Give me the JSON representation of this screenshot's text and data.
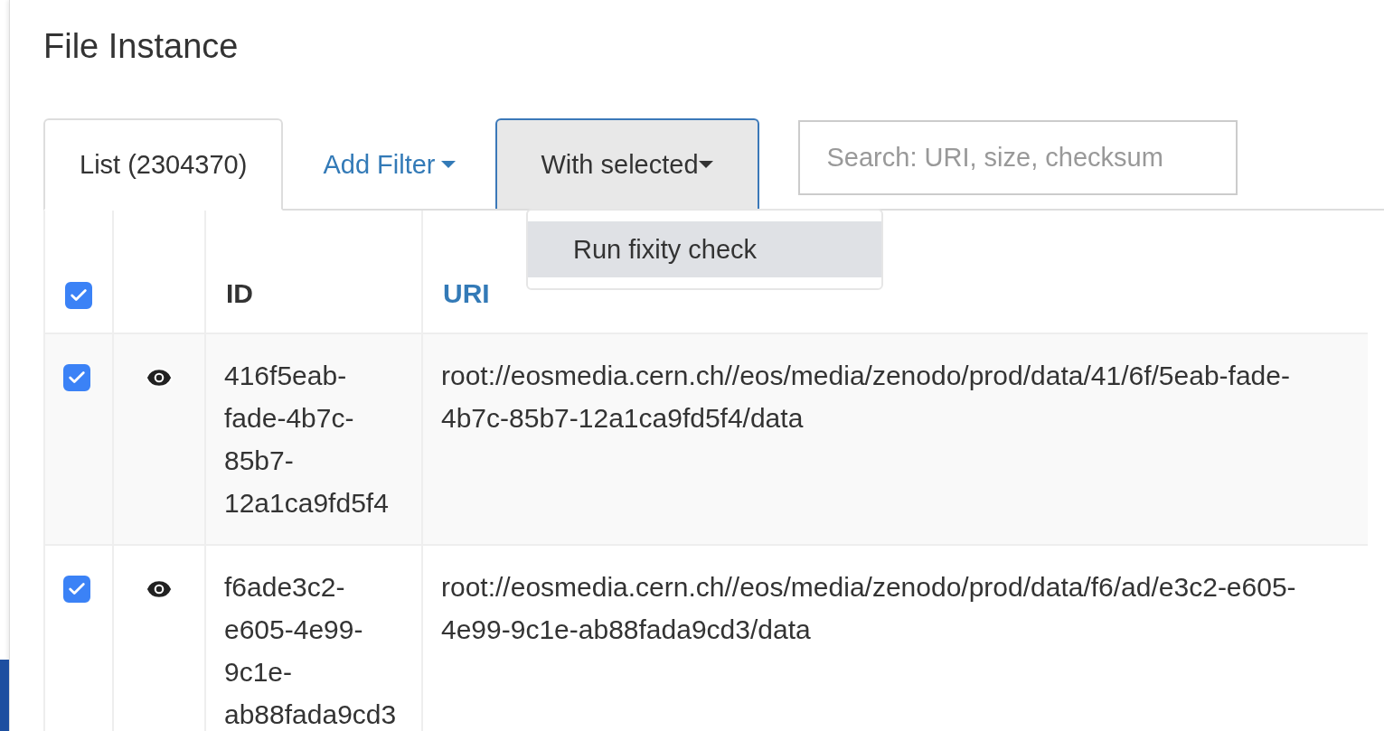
{
  "title": "File Instance",
  "tabs": [
    {
      "label": "List (2304370)",
      "selected": true,
      "kind": "tab"
    },
    {
      "label": "Add Filter",
      "kind": "dropdown-link"
    },
    {
      "label": "With selected",
      "kind": "dropdown-button",
      "open": true
    }
  ],
  "search": {
    "placeholder": "Search: URI, size, checksum"
  },
  "menu": {
    "items": [
      {
        "label": "Run fixity check",
        "selected": true
      }
    ]
  },
  "table": {
    "select_all": {
      "checked": true
    },
    "columns": [
      {
        "kind": "check"
      },
      {
        "kind": "view"
      },
      {
        "label": "ID",
        "kind": "plain"
      },
      {
        "label": "URI",
        "kind": "link"
      }
    ],
    "rows": [
      {
        "checked": true,
        "id": "416f5eab-fade-4b7c-85b7-12a1ca9fd5f4",
        "uri": "root://eosmedia.cern.ch//eos/media/zenodo/prod/data/41/6f/5eab-fade-4b7c-85b7-12a1ca9fd5f4/data"
      },
      {
        "checked": true,
        "id": "f6ade3c2-e605-4e99-9c1e-ab88fada9cd3",
        "uri": "root://eosmedia.cern.ch//eos/media/zenodo/prod/data/f6/ad/e3c2-e605-4e99-9c1e-ab88fada9cd3/data"
      }
    ]
  }
}
